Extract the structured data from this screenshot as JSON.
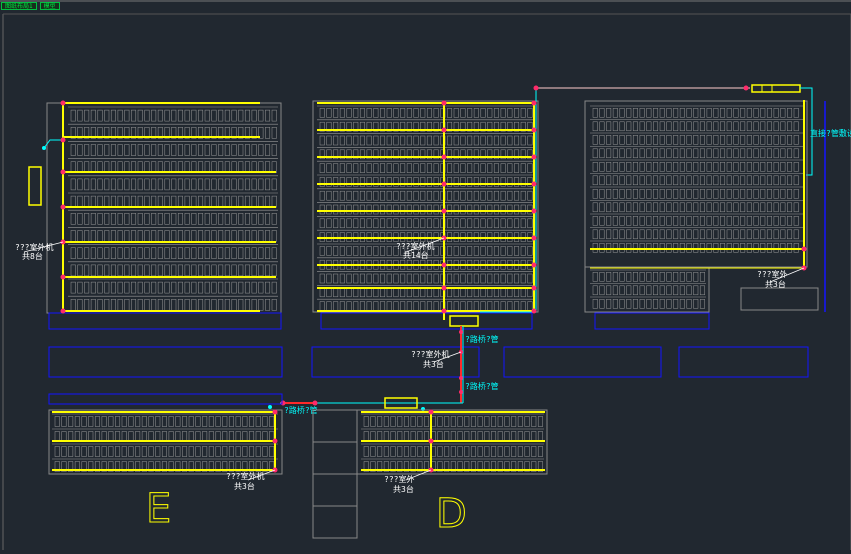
{
  "tabs": [
    "图纸布局1",
    "模型"
  ],
  "labels": {
    "callout_a1": "???室外机",
    "callout_a2": "共8台",
    "callout_b1": "???室外机",
    "callout_b2": "共14台",
    "callout_c1": "???室外",
    "callout_c2": "共3台",
    "callout_d1": "???室外机",
    "callout_d2": "共3台",
    "callout_e1": "???室外机",
    "callout_e2": "共3台",
    "callout_f1": "???室外",
    "callout_f2": "共3台",
    "pipe_1": "?路桥?管",
    "pipe_2": "?路桥?管",
    "pipe_3": "?路桥?管",
    "pipe_right": "直接?管敷设?",
    "zone_e": "E",
    "zone_d": "D"
  },
  "colors": {
    "background": "#212830",
    "grid": "#9a9a9a",
    "unit": "#ffff00",
    "pipe": "#00ffff",
    "node": "#ff2a6a",
    "outline": "#0000ff"
  }
}
